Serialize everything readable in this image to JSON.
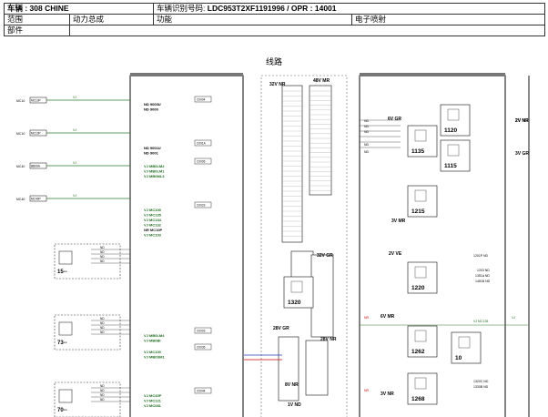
{
  "header": {
    "vehicle_label": "车辆 : 308 CHINE",
    "vin_label": "车辆识别号码: ",
    "vin_value": "LDC953T2XF1191996 / OPR : 14001",
    "range_label": "范围",
    "range_value": "动力总成",
    "function_label": "功能",
    "function_value": "电子喷射",
    "parts_label": "部件"
  },
  "diagram_title": "线路",
  "diagram": {
    "left_components": [
      {
        "code": "MC10",
        "connector": "MC10P"
      },
      {
        "code": "MC10",
        "connector": "MC10P"
      },
      {
        "code": "MC40",
        "connector": "BB00A"
      },
      {
        "code": "MC40",
        "connector": "MC40P"
      }
    ],
    "left_boxes": [
      {
        "number": "15--"
      },
      {
        "number": "73--"
      },
      {
        "number": "70--"
      }
    ],
    "central_panel": {
      "plates": [
        {
          "label": "C0004",
          "lines": [
            "ND 9000U",
            "ND 9000"
          ]
        },
        {
          "label": "C001A",
          "lines": [
            "ND 9001U",
            "ND 9001"
          ]
        },
        {
          "label": "C0006",
          "lines": [
            "VJ MB0LM2",
            "VJ MB0LM1",
            "VJ MB0ML3"
          ]
        },
        {
          "label": "C0023",
          "lines": [
            "VJ MC100",
            "VJ MC135",
            "VJ MC134",
            "VJ MC132",
            "NR MC10P",
            "VJ MC103"
          ]
        },
        {
          "label": "C0003",
          "lines": [
            "VJ MB0LM4",
            "VJ MB0BI"
          ]
        },
        {
          "label": "C0036",
          "lines": [
            "VJ MC100",
            "VJ MB0SM1"
          ]
        },
        {
          "label": "C0044",
          "lines": [
            "VJ MC40P",
            "VJ MC121",
            "VJ MC081"
          ]
        }
      ]
    },
    "connectors": [
      {
        "name": "32V NR"
      },
      {
        "name": "48V MR"
      },
      {
        "name": "32V GR"
      },
      {
        "name": "28V GR"
      },
      {
        "name": "2V NR"
      },
      {
        "name": "28V NR"
      },
      {
        "name": "8V NR"
      },
      {
        "name": "1V ND"
      },
      {
        "name": "6V GR"
      },
      {
        "name": "3V MR"
      },
      {
        "name": "2V VE"
      },
      {
        "name": "6V MR"
      },
      {
        "name": "3V NR"
      },
      {
        "name": "2V NR"
      },
      {
        "name": "3V GR"
      }
    ],
    "modules": [
      {
        "number": "1320"
      },
      {
        "number": "1135"
      },
      {
        "number": "1215"
      },
      {
        "number": "1220"
      },
      {
        "number": "1262"
      },
      {
        "number": "1268"
      },
      {
        "number": "1120"
      },
      {
        "number": "1115"
      },
      {
        "number": "10"
      }
    ],
    "right_labels": [
      "1201P ND",
      "1203 ND",
      "1351A ND",
      "1451B ND",
      "VJ MC135",
      "VJ",
      "1320C ND",
      "1330B ND"
    ],
    "left_labels": [
      "ND",
      "ND",
      "ND",
      "ND",
      "ND",
      "NR",
      "NR"
    ]
  }
}
